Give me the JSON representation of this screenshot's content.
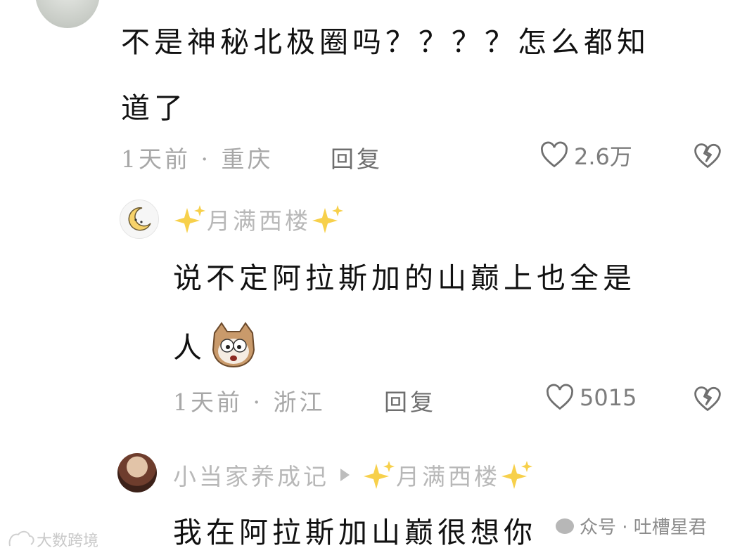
{
  "comment_1": {
    "text_line1": "不是神秘北极圈吗？？？？怎么都知",
    "text_line2": "道了",
    "meta": "1天前 · 重庆",
    "reply_label": "回复",
    "likes": "2.6万"
  },
  "reply_1": {
    "username": "月满西楼",
    "text_line1": "说不定阿拉斯加的山巅上也全是",
    "text_line2": "人",
    "emoji": "doge-face-emoji",
    "meta": "1天前 · 浙江",
    "reply_label": "回复",
    "likes": "5015"
  },
  "reply_2": {
    "username": "小当家养成记",
    "reply_to": "月满西楼",
    "text_line1": "我在阿拉斯加山巅很想你"
  },
  "watermarks": {
    "left": "大数跨境",
    "right": "众号 · 吐槽星君"
  },
  "colors": {
    "text": "#111111",
    "meta": "#a7a7a7",
    "username": "#b8b8b8",
    "sparkle": "#f7d04b"
  }
}
